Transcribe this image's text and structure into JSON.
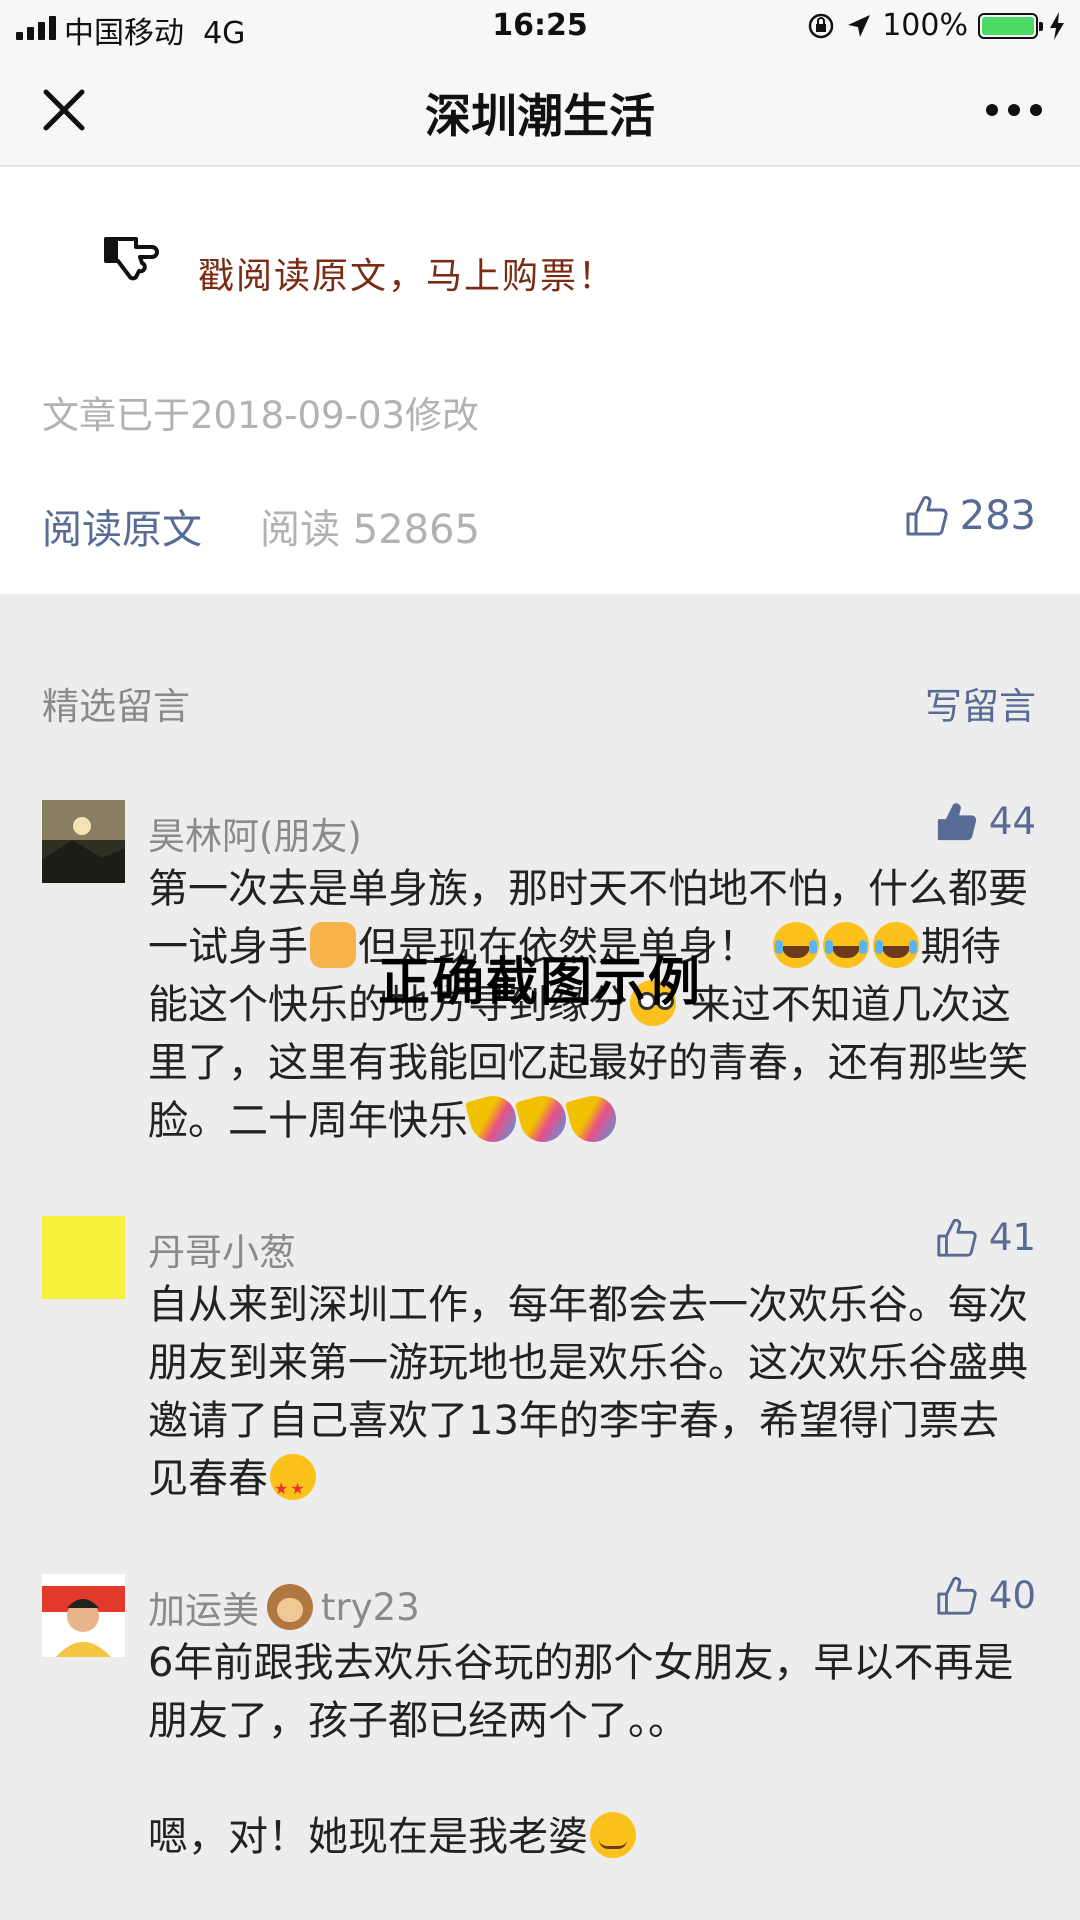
{
  "status_bar": {
    "carrier": "中国移动",
    "network": "4G",
    "time": "16:25",
    "battery": "100%",
    "battery_level": 1.0,
    "icons": [
      "signal-icon",
      "lock-rotation-icon",
      "location-arrow-icon",
      "battery-icon",
      "charging-icon"
    ]
  },
  "nav": {
    "title": "深圳潮生活",
    "close_icon": "close-icon",
    "more_icon": "more-icon"
  },
  "article": {
    "promo_icon": "pointing-hand-icon",
    "promo_text": "戳阅读原文，马上购票！",
    "modified": "文章已于2018-09-03修改",
    "read_original": "阅读原文",
    "reads": "阅读 52865",
    "likes": "283"
  },
  "comments_header": {
    "title": "精选留言",
    "write": "写留言"
  },
  "comments": [
    {
      "nickname": "昊林阿(朋友)",
      "likes": "44",
      "liked": true,
      "avatar_colors": [
        "#3a3a2a",
        "#c9b38a"
      ],
      "text_1": "第一次去是单身族，那时天不怕地不怕，什么都要一试身手",
      "text_2": "但是现在依然是单身！",
      "text_3": "期待能这个快乐的地方寻到缘分",
      "text_4": " 来过不知道几次这里了，这里有我能回忆起最好的青春，还有那些笑脸。二十周年快乐"
    },
    {
      "nickname": "丹哥小葱",
      "likes": "41",
      "liked": false,
      "avatar_colors": [
        "#f8ee3c"
      ],
      "text": "自从来到深圳工作，每年都会去一次欢乐谷。每次朋友到来第一游玩地也是欢乐谷。这次欢乐谷盛典邀请了自己喜欢了13年的李宇春，希望得门票去见春春"
    },
    {
      "nickname_a": "加运美",
      "nickname_b": "try23",
      "likes": "40",
      "liked": false,
      "avatar_colors": [
        "#e23a2a",
        "#f4c542"
      ],
      "text_1": "6年前跟我去欢乐谷玩的那个女朋友，早以不再是朋友了，孩子都已经两个了。。",
      "text_2": "嗯，对！她现在是我老婆"
    }
  ],
  "watermark": "正确截图示例",
  "colors": {
    "link": "#576b95",
    "promo": "#7b2b14",
    "muted": "#b2b2b2",
    "background": "#ededed"
  }
}
